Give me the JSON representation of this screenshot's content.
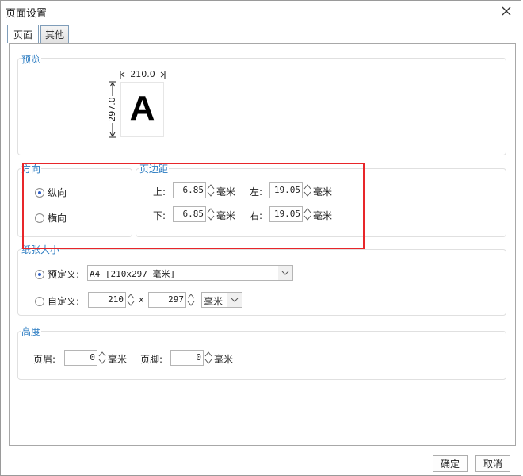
{
  "dialog": {
    "title": "页面设置",
    "close_icon": "close-icon"
  },
  "tabs": [
    {
      "label": "页面",
      "active": true
    },
    {
      "label": "其他",
      "active": false
    }
  ],
  "preview": {
    "legend": "预览",
    "width_label": "210.0",
    "height_label": "297.0",
    "letter": "A"
  },
  "orientation": {
    "legend": "方向",
    "portrait_label": "纵向",
    "landscape_label": "横向",
    "selected": "portrait"
  },
  "margins": {
    "legend": "页边距",
    "top_label": "上:",
    "top_value": "6.85",
    "bottom_label": "下:",
    "bottom_value": "6.85",
    "left_label": "左:",
    "left_value": "19.05",
    "right_label": "右:",
    "right_value": "19.05",
    "unit": "毫米"
  },
  "paper": {
    "legend": "纸张大小",
    "predefined_label": "预定义:",
    "predefined_value": "A4 [210x297 毫米]",
    "custom_label": "自定义:",
    "custom_width": "210",
    "times": "x",
    "custom_height": "297",
    "custom_unit": "毫米",
    "selected": "predefined"
  },
  "height": {
    "legend": "高度",
    "header_label": "页眉:",
    "header_value": "0",
    "footer_label": "页脚:",
    "footer_value": "0",
    "unit": "毫米"
  },
  "buttons": {
    "ok": "确定",
    "cancel": "取消"
  },
  "colors": {
    "legend_blue": "#2a7bc1",
    "highlight_red": "#e8262a"
  }
}
